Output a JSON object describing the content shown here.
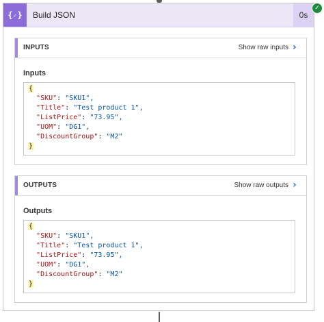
{
  "action": {
    "title": "Build JSON",
    "duration": "0s",
    "icon": "code-braces-icon",
    "status_icon": "success-check-icon",
    "accent_color": "#8c6cd9",
    "status_color": "#1e8a3e"
  },
  "inputs": {
    "section_title": "INPUTS",
    "raw_link": "Show raw inputs",
    "field_label": "Inputs",
    "json": {
      "open": "{",
      "close": "}",
      "lines": [
        {
          "key": "\"SKU\"",
          "value": "\"SKU1\","
        },
        {
          "key": "\"Title\"",
          "value": "\"Test product 1\","
        },
        {
          "key": "\"ListPrice\"",
          "value": "\"73.95\","
        },
        {
          "key": "\"UOM\"",
          "value": "\"DG1\","
        },
        {
          "key": "\"DiscountGroup\"",
          "value": "\"M2\""
        }
      ]
    }
  },
  "outputs": {
    "section_title": "OUTPUTS",
    "raw_link": "Show raw outputs",
    "field_label": "Outputs",
    "json": {
      "open": "{",
      "close": "}",
      "lines": [
        {
          "key": "\"SKU\"",
          "value": "\"SKU1\","
        },
        {
          "key": "\"Title\"",
          "value": "\"Test product 1\","
        },
        {
          "key": "\"ListPrice\"",
          "value": "\"73.95\","
        },
        {
          "key": "\"UOM\"",
          "value": "\"DG1\","
        },
        {
          "key": "\"DiscountGroup\"",
          "value": "\"M2\""
        }
      ]
    }
  }
}
